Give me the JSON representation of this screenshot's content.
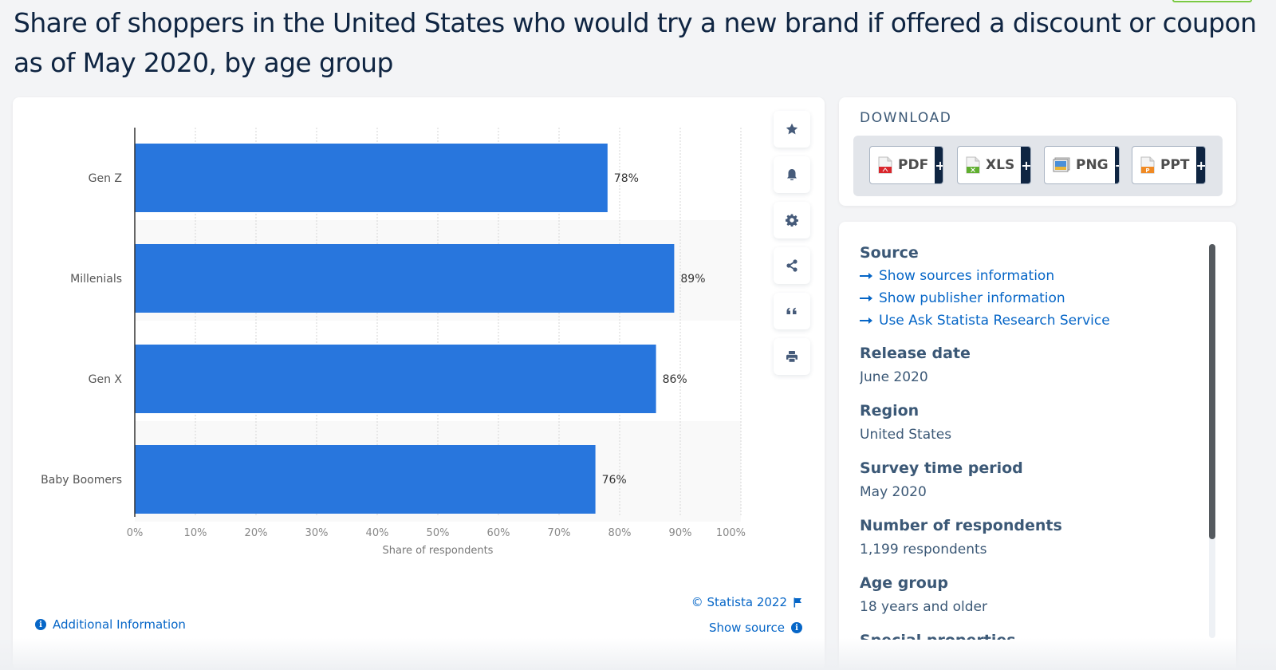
{
  "page": {
    "title": "Share of shoppers in the United States who would try a new brand if offered a discount or coupon as of May 2020, by age group"
  },
  "colors": {
    "bar": "#2876dd",
    "accent_link": "#0666c7",
    "title": "#0f2542",
    "heading": "#3b5876",
    "band": "#f9f9f9"
  },
  "chart_data": {
    "type": "bar",
    "orientation": "horizontal",
    "title": "Share of shoppers in the United States who would try a new brand if offered a discount or coupon as of May 2020, by age group",
    "categories": [
      "Gen Z",
      "Millenials",
      "Gen X",
      "Baby Boomers"
    ],
    "values": [
      78,
      89,
      86,
      76
    ],
    "value_labels": [
      "78%",
      "89%",
      "86%",
      "76%"
    ],
    "xlabel": "Share of respondents",
    "ylabel": "",
    "xlim": [
      0,
      100
    ],
    "ticks": [
      0,
      10,
      20,
      30,
      40,
      50,
      60,
      70,
      80,
      90,
      100
    ],
    "tick_labels": [
      "0%",
      "10%",
      "20%",
      "30%",
      "40%",
      "50%",
      "60%",
      "70%",
      "80%",
      "90%",
      "100%"
    ],
    "grid": true,
    "legend": "none"
  },
  "toolbar": {
    "items": [
      {
        "name": "favorite",
        "icon": "star-icon"
      },
      {
        "name": "notification",
        "icon": "bell-icon"
      },
      {
        "name": "settings",
        "icon": "gear-icon"
      },
      {
        "name": "share",
        "icon": "share-icon"
      },
      {
        "name": "cite",
        "icon": "quote-icon"
      },
      {
        "name": "print",
        "icon": "print-icon"
      }
    ]
  },
  "chart_footer": {
    "copyright": "© Statista 2022",
    "show_source": "Show source",
    "additional_info": "Additional Information"
  },
  "download": {
    "title": "DOWNLOAD",
    "buttons": [
      {
        "label": "PDF",
        "plus": "+",
        "icon": "pdf-file-icon"
      },
      {
        "label": "XLS",
        "plus": "+",
        "icon": "xls-file-icon"
      },
      {
        "label": "PNG",
        "plus": "+",
        "icon": "png-image-icon"
      },
      {
        "label": "PPT",
        "plus": "+",
        "icon": "ppt-file-icon"
      }
    ]
  },
  "info": {
    "source_heading": "Source",
    "links": [
      "Show sources information",
      "Show publisher information",
      "Use Ask Statista Research Service"
    ],
    "release_date_heading": "Release date",
    "release_date": "June 2020",
    "region_heading": "Region",
    "region": "United States",
    "survey_period_heading": "Survey time period",
    "survey_period": "May 2020",
    "respondents_heading": "Number of respondents",
    "respondents": "1,199 respondents",
    "age_group_heading": "Age group",
    "age_group": "18 years and older",
    "next_heading_partial": "Special properties"
  }
}
